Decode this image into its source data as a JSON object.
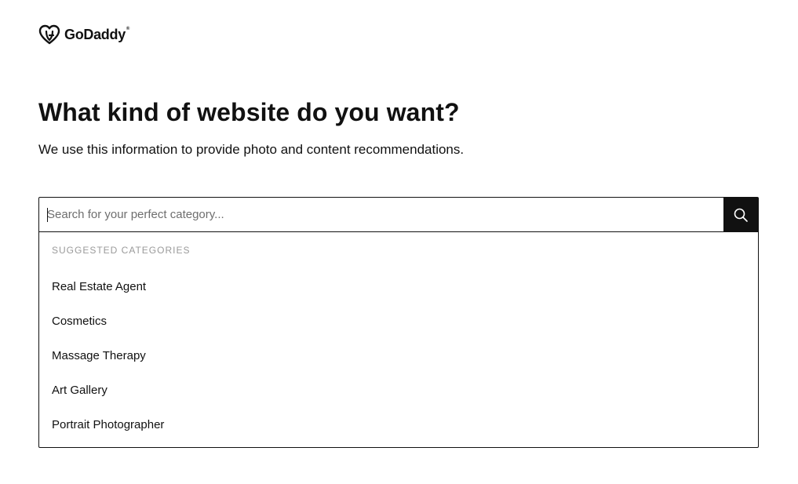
{
  "brand": {
    "name": "GoDaddy",
    "tm": "®"
  },
  "page": {
    "title": "What kind of website do you want?",
    "subtitle": "We use this information to provide photo and content recommendations."
  },
  "search": {
    "placeholder": "Search for your perfect category...",
    "value": "",
    "button_icon": "search-icon"
  },
  "suggestions": {
    "heading": "SUGGESTED CATEGORIES",
    "items": [
      "Real Estate Agent",
      "Cosmetics",
      "Massage Therapy",
      "Art Gallery",
      "Portrait Photographer"
    ]
  },
  "colors": {
    "text": "#111111",
    "muted": "#9a9a9a",
    "button_bg": "#111111",
    "border": "#111111"
  }
}
